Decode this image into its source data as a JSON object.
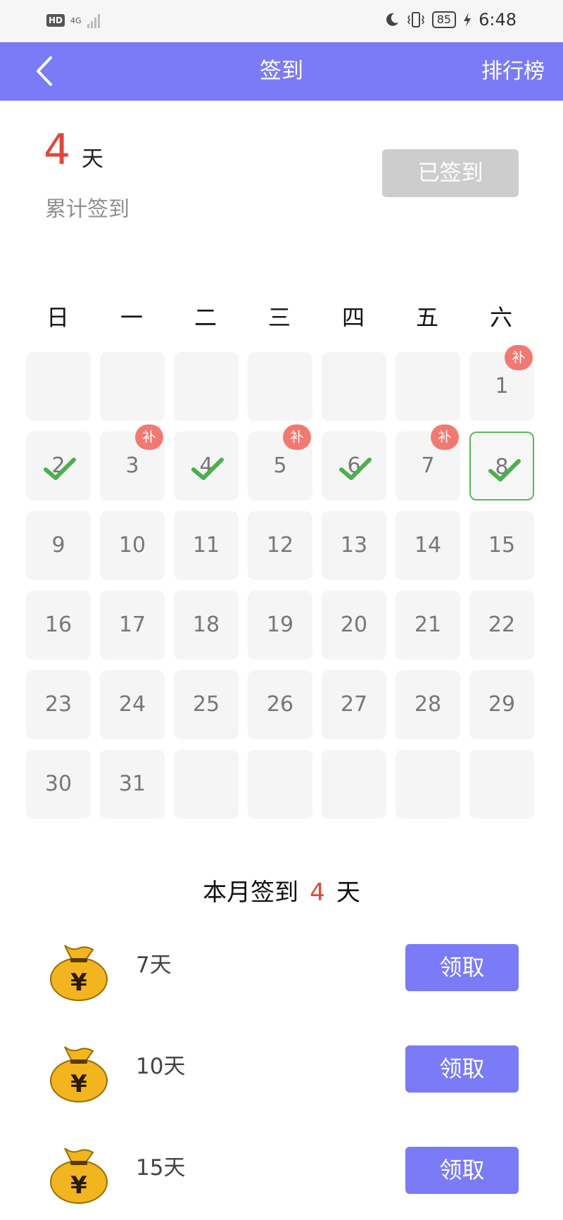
{
  "status_bar": {
    "hd": "HD",
    "network": "4G",
    "battery": "85",
    "time": "6:48",
    "icons": [
      "signal-icon",
      "moon-icon",
      "vibrate-icon",
      "battery-icon",
      "charging-icon"
    ]
  },
  "header": {
    "title": "签到",
    "right_link": "排行榜",
    "background": "#7b7bf7"
  },
  "summary": {
    "total_days": "4",
    "unit": "天",
    "label": "累计签到",
    "signed_button": "已签到"
  },
  "weekdays": [
    "日",
    "一",
    "二",
    "三",
    "四",
    "五",
    "六"
  ],
  "calendar": {
    "leading_blanks": 6,
    "days_in_month": 31,
    "signed_days": [
      2,
      4,
      6,
      8
    ],
    "makeup_days": [
      1,
      3,
      5,
      7
    ],
    "today": 8,
    "makeup_badge": "补",
    "check_color": "#4caf50",
    "badge_color": "#f07a72"
  },
  "monthly": {
    "prefix": "本月签到",
    "count": "4",
    "suffix": "天"
  },
  "rewards": [
    {
      "label": "7天",
      "button": "领取",
      "icon": "money-bag-icon"
    },
    {
      "label": "10天",
      "button": "领取",
      "icon": "money-bag-icon"
    },
    {
      "label": "15天",
      "button": "领取",
      "icon": "money-bag-icon"
    }
  ]
}
